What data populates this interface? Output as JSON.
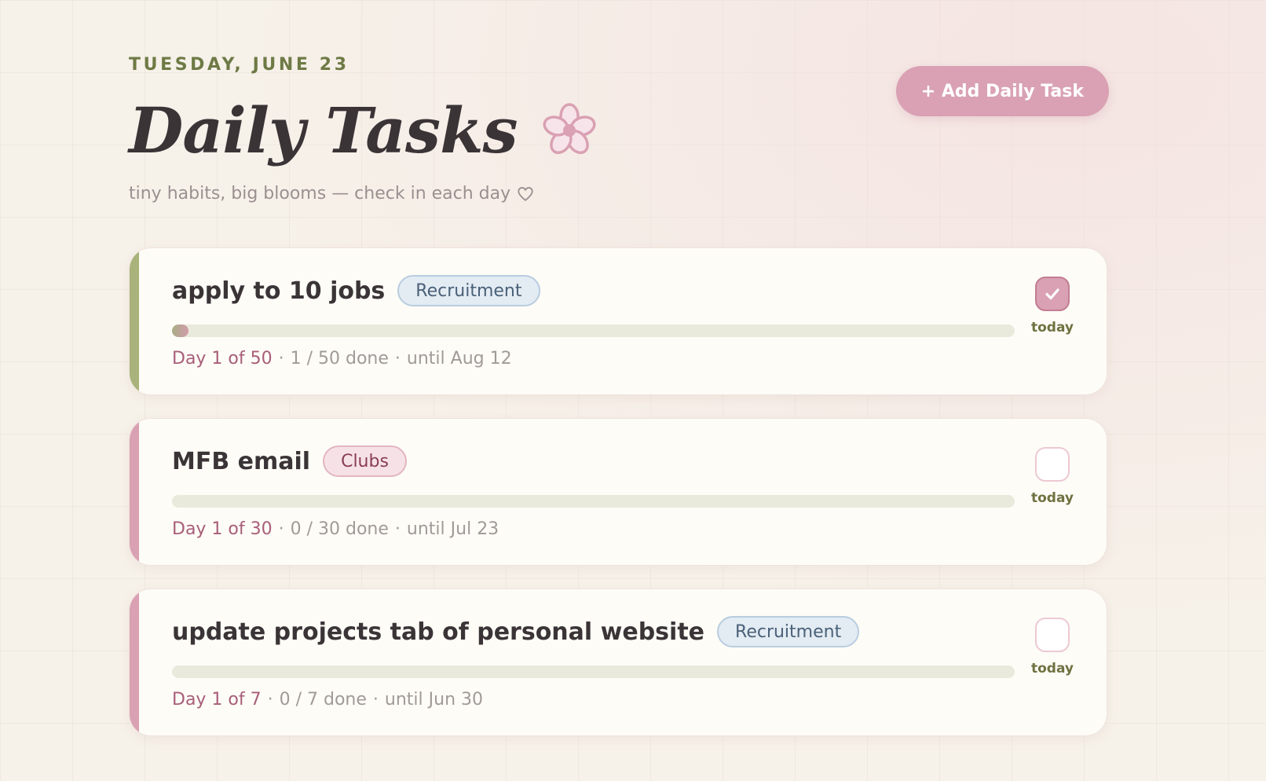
{
  "header": {
    "date": "TUESDAY, JUNE 23",
    "title": "Daily Tasks",
    "subtitle": "tiny habits, big blooms — check in each day",
    "add_button_label": "+ Add Daily Task",
    "title_icon": "flower-icon",
    "subtitle_icon": "heart-icon"
  },
  "colors": {
    "accent_pink": "#d9a1b3",
    "accent_green": "#a8b27a",
    "date_green": "#6e7a45",
    "day_count": "#a85e79",
    "tag_blue_bg": "#e3ebf3",
    "tag_pink_bg": "#f6e2e6"
  },
  "tasks": [
    {
      "name": "apply to 10 jobs",
      "tag": "Recruitment",
      "tag_color": "blue",
      "accent": "#a8b27a",
      "progress": 0.02,
      "day": "Day 1 of 50",
      "done": "1 / 50 done",
      "until": "until Aug 12",
      "checked": true,
      "check_label": "today"
    },
    {
      "name": "MFB email",
      "tag": "Clubs",
      "tag_color": "pink",
      "accent": "#d9a1b3",
      "progress": 0,
      "day": "Day 1 of 30",
      "done": "0 / 30 done",
      "until": "until Jul 23",
      "checked": false,
      "check_label": "today"
    },
    {
      "name": "update projects tab of personal website",
      "tag": "Recruitment",
      "tag_color": "blue",
      "accent": "#d9a1b3",
      "progress": 0,
      "day": "Day 1 of 7",
      "done": "0 / 7 done",
      "until": "until Jun 30",
      "checked": false,
      "check_label": "today"
    }
  ]
}
